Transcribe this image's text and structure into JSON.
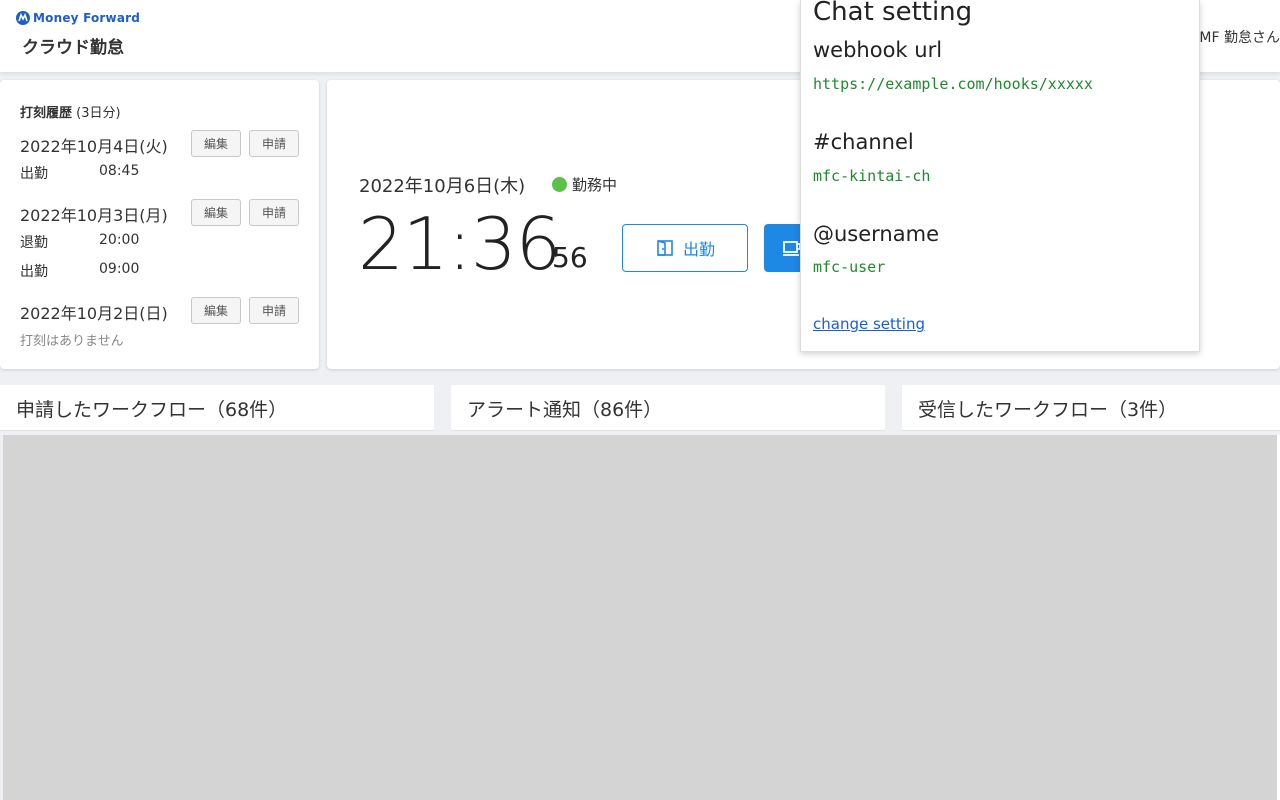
{
  "header": {
    "brand": "Money Forward",
    "product": "クラウド勤怠",
    "user": "MF 勤怠さん"
  },
  "history": {
    "title": "打刻履歴",
    "count": "(3日分)",
    "edit_label": "編集",
    "request_label": "申請",
    "days": [
      {
        "date": "2022年10月4日(火)",
        "punches": [
          {
            "type": "出勤",
            "time": "08:45"
          }
        ]
      },
      {
        "date": "2022年10月3日(月)",
        "punches": [
          {
            "type": "退勤",
            "time": "20:00"
          },
          {
            "type": "出勤",
            "time": "09:00"
          }
        ]
      },
      {
        "date": "2022年10月2日(日)",
        "empty": "打刻はありません"
      }
    ]
  },
  "clock": {
    "date": "2022年10月6日(木)",
    "status": "勤務中",
    "status_color": "#5cc04a",
    "time": "21:36",
    "seconds": "56",
    "clock_in_label": "出勤",
    "accent": "#1e88e5"
  },
  "panels": [
    {
      "title": "申請したワークフロー（68件）"
    },
    {
      "title": "アラート通知（86件）"
    },
    {
      "title": "受信したワークフロー（3件）"
    }
  ],
  "popup": {
    "title": "Chat setting",
    "webhook_label": "webhook url",
    "webhook_value": "https://example.com/hooks/xxxxx",
    "channel_label": "#channel",
    "channel_value": "mfc-kintai-ch",
    "username_label": "@username",
    "username_value": "mfc-user",
    "change_link": "change setting",
    "value_color": "#1e8a2e"
  }
}
